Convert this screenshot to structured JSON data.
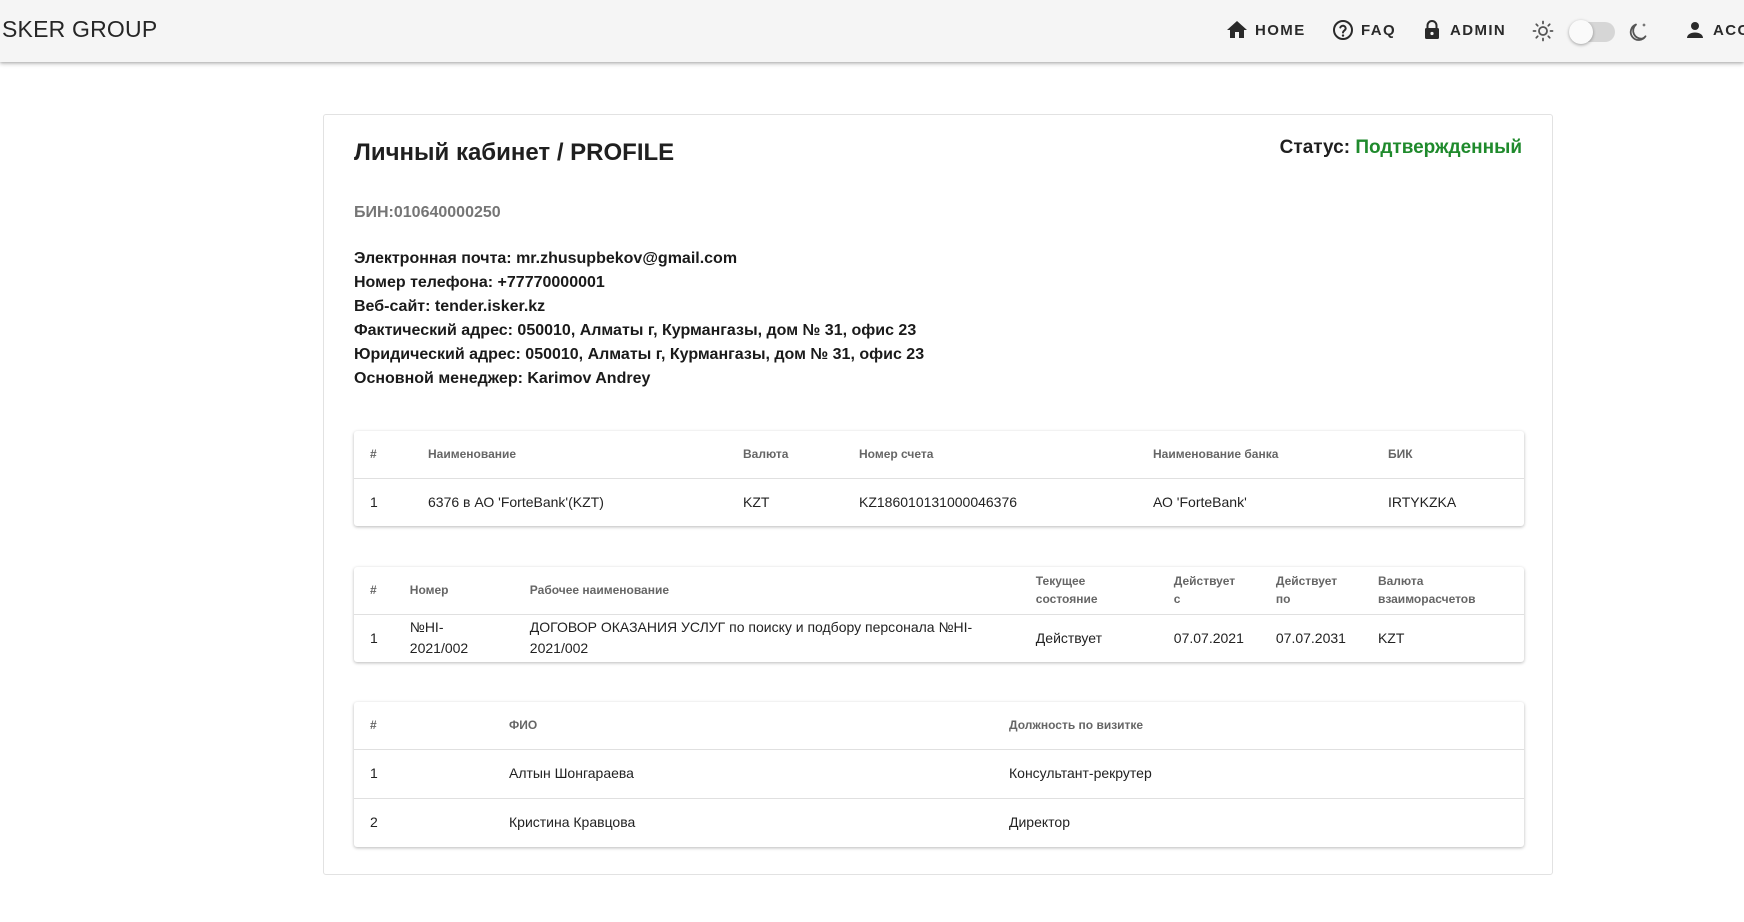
{
  "header": {
    "brand": "SKER GROUP",
    "nav": [
      {
        "label": "HOME",
        "icon": "home-icon"
      },
      {
        "label": "FAQ",
        "icon": "help-circle-icon"
      },
      {
        "label": "ADMIN",
        "icon": "lock-icon"
      },
      {
        "label": "ACC",
        "icon": "person-icon"
      }
    ],
    "theme_toggle": {
      "light_icon": "sun-icon",
      "dark_icon": "moon-icon",
      "checked": false
    }
  },
  "profile": {
    "title": "Личный кабинет / PROFILE",
    "status_label": "Статус:",
    "status_value": "Подтвержденный",
    "status_color": "#1f8a2c",
    "bin": "БИН:010640000250",
    "info": [
      "Электронная почта: mr.zhusupbekov@gmail.com",
      "Номер телефона: +77770000001",
      "Веб-сайт: tender.isker.kz",
      "Фактический адрес: 050010, Алматы г, Курмангазы, дом № 31, офис 23",
      "Юридический адрес: 050010, Алматы г, Курмангазы, дом № 31, офис 23",
      "Основной менеджер: Karimov Andrey"
    ]
  },
  "accounts_table": {
    "headers": [
      "#",
      "Наименование",
      "Валюта",
      "Номер счета",
      "Наименование банка",
      "БИК"
    ],
    "rows": [
      [
        "1",
        "6376 в АО 'ForteBank'(KZT)",
        "KZT",
        "KZ186010131000046376",
        "АО 'ForteBank'",
        "IRTYKZKA"
      ]
    ]
  },
  "contracts_table": {
    "headers": [
      "#",
      "Номер",
      "Рабочее наименование",
      "Текущее состояние",
      "Действует с",
      "Действует по",
      "Валюта взаиморасчетов"
    ],
    "rows": [
      [
        "1",
        "№HI-2021/002",
        "ДОГОВОР ОКАЗАНИЯ УСЛУГ по поиску и подбору персонала №HI-2021/002",
        "Действует",
        "07.07.2021",
        "07.07.2031",
        "KZT"
      ]
    ]
  },
  "contacts_table": {
    "headers": [
      "#",
      "ФИО",
      "Должность по визитке"
    ],
    "rows": [
      [
        "1",
        "Алтын Шонгараева",
        "Консультант-рекрутер"
      ],
      [
        "2",
        "Кристина Кравцова",
        "Директор"
      ]
    ]
  }
}
